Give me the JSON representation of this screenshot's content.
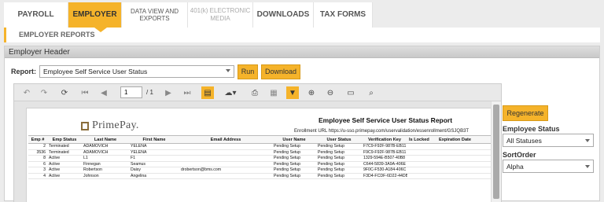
{
  "nav": {
    "tabs": [
      {
        "label": "PAYROLL"
      },
      {
        "label": "EMPLOYER"
      },
      {
        "label": "DATA VIEW AND EXPORTS"
      },
      {
        "label": "401(k) ELECTRONIC MEDIA"
      },
      {
        "label": "DOWNLOADS"
      },
      {
        "label": "TAX FORMS"
      }
    ],
    "subnav": "EMPLOYER REPORTS"
  },
  "panel": {
    "title": "Employer Header",
    "report_label": "Report:",
    "report_value": "Employee Self Service User Status",
    "run_label": "Run",
    "download_label": "Download"
  },
  "viewer": {
    "page_current": "1",
    "page_total": "/ 1"
  },
  "document": {
    "logo_text": "PrimePay.",
    "title": "Employee Self Service User Status Report",
    "subtitle": "Enrollment URL https://u-sso.primepay.com/uservalidation/essenrollment/GSJQB3T",
    "columns": [
      "Emp #",
      "Emp Status",
      "Last Name",
      "First Name",
      "Email Address",
      "User Name",
      "User Status",
      "Verification Key",
      "Is Locked",
      "Expiration Date"
    ],
    "rows": [
      [
        "2",
        "Terminated",
        "ADAMOVICH",
        "YELENA",
        "",
        "Pending Setup",
        "Pending Setup",
        "F7C9-F92F-987B-EB11",
        "",
        ""
      ],
      [
        "3536",
        "Terminated",
        "ADAMOVICH",
        "YELENA",
        "",
        "Pending Setup",
        "Pending Setup",
        "F9C9-F92F-987B-EB11",
        "",
        ""
      ],
      [
        "8",
        "Active",
        "L1",
        "F1",
        "",
        "Pending Setup",
        "Pending Setup",
        "1329-594E-B507-40B8",
        "",
        ""
      ],
      [
        "6",
        "Active",
        "Finnegan",
        "Seamus",
        "",
        "Pending Setup",
        "Pending Setup",
        "C644-5839-3A9A-406E",
        "",
        ""
      ],
      [
        "3",
        "Active",
        "Robertson",
        "Daisy",
        "drobertson@bms.com",
        "Pending Setup",
        "Pending Setup",
        "9F0C-F530-A184-406C",
        "",
        ""
      ],
      [
        "4",
        "Active",
        "Johnson",
        "Angelina",
        "",
        "Pending Setup",
        "Pending Setup",
        "F3D4-FCDF-6D22-44DB",
        "",
        ""
      ]
    ]
  },
  "side": {
    "regenerate_label": "Regenerate",
    "employee_status_label": "Employee Status",
    "employee_status_value": "All Statuses",
    "sort_order_label": "SortOrder",
    "sort_order_value": "Alpha"
  },
  "colors": {
    "accent": "#f5b32a",
    "header_bg": "#d4d4d4"
  }
}
